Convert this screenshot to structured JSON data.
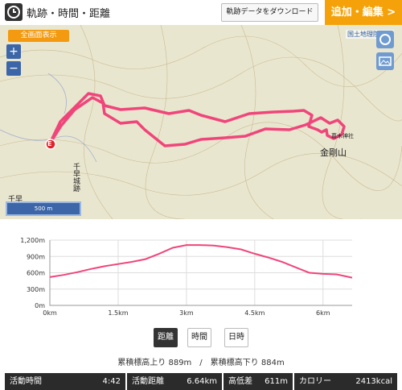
{
  "header": {
    "title": "軌跡・時間・距離",
    "download_label": "軌跡データをダウンロード",
    "add_edit_label": "追加・編集 >"
  },
  "map": {
    "fullscreen_label": "全画面表示",
    "zoom_in": "+",
    "zoom_out": "−",
    "gsi_label": "国土地理院地図",
    "scale_label": "500 m",
    "start_marker": "E",
    "places": [
      "千早城跡",
      "千早",
      "金剛山",
      "葛木神社"
    ],
    "track_color": "#f0457a"
  },
  "chart_data": {
    "type": "line",
    "x": [
      0,
      0.3,
      0.6,
      0.9,
      1.2,
      1.5,
      1.8,
      2.1,
      2.4,
      2.7,
      3.0,
      3.3,
      3.6,
      3.9,
      4.2,
      4.5,
      4.8,
      5.1,
      5.4,
      5.7,
      6.0,
      6.3,
      6.64
    ],
    "y": [
      520,
      560,
      610,
      670,
      720,
      760,
      800,
      850,
      950,
      1060,
      1110,
      1110,
      1100,
      1070,
      1030,
      950,
      880,
      800,
      700,
      600,
      580,
      570,
      510
    ],
    "xlim": [
      0,
      6.64
    ],
    "ylim": [
      0,
      1200
    ],
    "x_ticks": [
      "0km",
      "1.5km",
      "3km",
      "4.5km",
      "6km"
    ],
    "x_tick_values": [
      0,
      1.5,
      3,
      4.5,
      6
    ],
    "y_ticks": [
      "0m",
      "300m",
      "600m",
      "900m",
      "1,200m"
    ],
    "y_tick_values": [
      0,
      300,
      600,
      900,
      1200
    ],
    "color": "#f0457a"
  },
  "tabs": [
    "距離",
    "時間",
    "日時"
  ],
  "summary": "累積標高上り 889m　/　累積標高下り 884m",
  "stats": [
    {
      "label": "活動時間",
      "value": "4:42"
    },
    {
      "label": "活動距離",
      "value": "6.64km"
    },
    {
      "label": "高低差",
      "value": "611m"
    },
    {
      "label": "カロリー",
      "value": "2413kcal"
    }
  ]
}
